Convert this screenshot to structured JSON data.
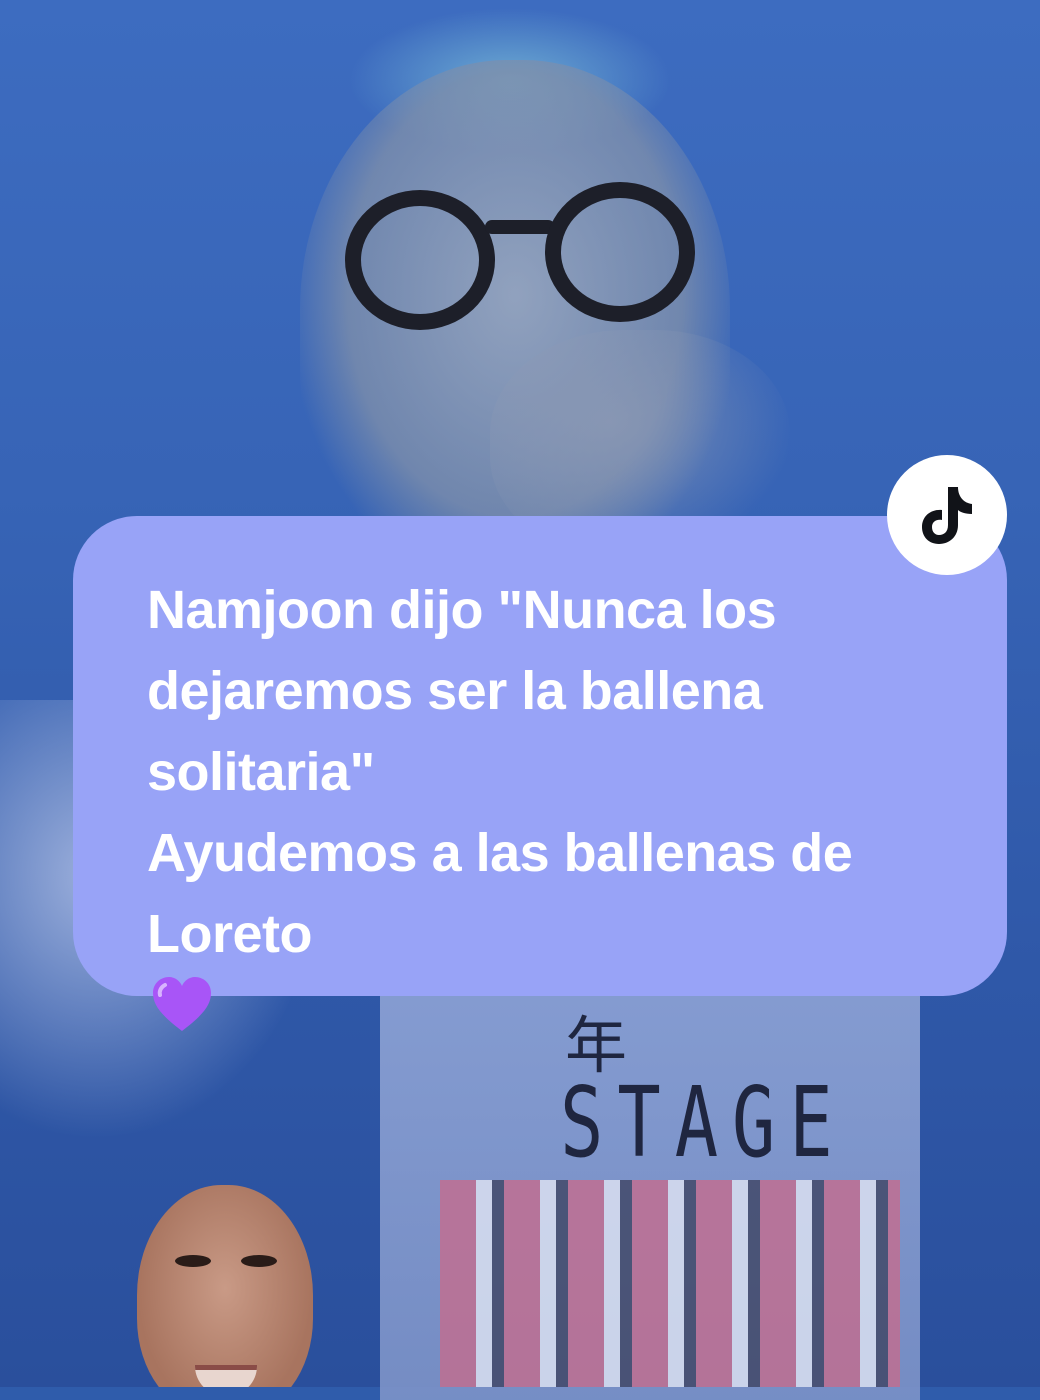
{
  "caption": {
    "lines": [
      "Namjoon dijo \"Nunca los",
      "dejaremos ser la ballena",
      "solitaria\"",
      "Ayudemos a las ballenas de",
      "Loreto"
    ],
    "emoji": "purple-heart",
    "background_color": "#98a3f7",
    "text_color": "#ffffff"
  },
  "video_overlay_text": {
    "shirt_cjk": "年",
    "shirt_word": "STAGE"
  },
  "badge": {
    "icon": "tiktok-logo-icon"
  },
  "pip": {
    "description_icon": "creator-camera-avatar"
  },
  "colors": {
    "video_blue": "#2f5cab",
    "heart_purple": "#a855f7"
  }
}
